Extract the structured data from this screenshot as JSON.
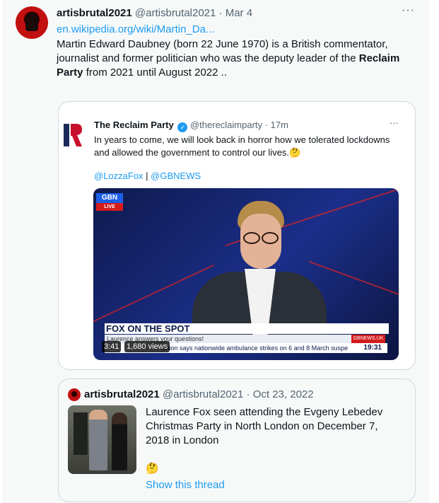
{
  "tweet": {
    "author_name": "artisbrutal2021",
    "author_handle": "@artisbrutal2021",
    "dot": "·",
    "date": "Mar 4",
    "more_icon": "···",
    "link_text": "en.wikipedia.org/wiki/Martin_Da...",
    "bio_part1": "Martin Edward Daubney (born 22 June 1970) is a British commentator, journalist and former politician who was the deputy leader of the ",
    "bio_bold1": "Reclaim",
    "bio_space": " ",
    "bio_bold2": "Party",
    "bio_part2": " from 2021 until August 2022 .."
  },
  "quoted_tweet": {
    "author_name": "The Reclaim Party",
    "verified_icon": "✓",
    "author_handle": "@thereclaimparty",
    "dot": "·",
    "time": "17m",
    "more_icon": "···",
    "text": "In years to come, we will look back in horror how we tolerated lockdowns and allowed the government to control our lives.🤔",
    "mention1": "@LozzaFox",
    "separator": " | ",
    "mention2": "@GBNEWS",
    "video": {
      "channel_logo": "GBN",
      "live_label": "LIVE",
      "lower_third_title": "FOX ON THE SPOT",
      "lower_third_sub": "Laurence answers your questions!",
      "channel_site": "GBNEWS.UK",
      "ticker_text": "Union says nationwide ambulance strikes on 6 and 8 March suspe",
      "ticker_time": "19:31",
      "duration": "3:41",
      "views": "1,680 views"
    }
  },
  "thread_tweet": {
    "author_name": "artisbrutal2021",
    "author_handle": "@artisbrutal2021",
    "dot": "·",
    "date": "Oct 23, 2022",
    "text": "Laurence Fox seen attending the Evgeny Lebedev Christmas Party in North London on December 7, 2018 in London",
    "emoji": "🤔",
    "show_thread": "Show this thread"
  },
  "colors": {
    "accent": "#1d9bf0",
    "text": "#0f1419",
    "muted": "#536471",
    "border": "#cfd9de",
    "reclaim_red": "#c8102e",
    "reclaim_navy": "#1a2a5a"
  }
}
